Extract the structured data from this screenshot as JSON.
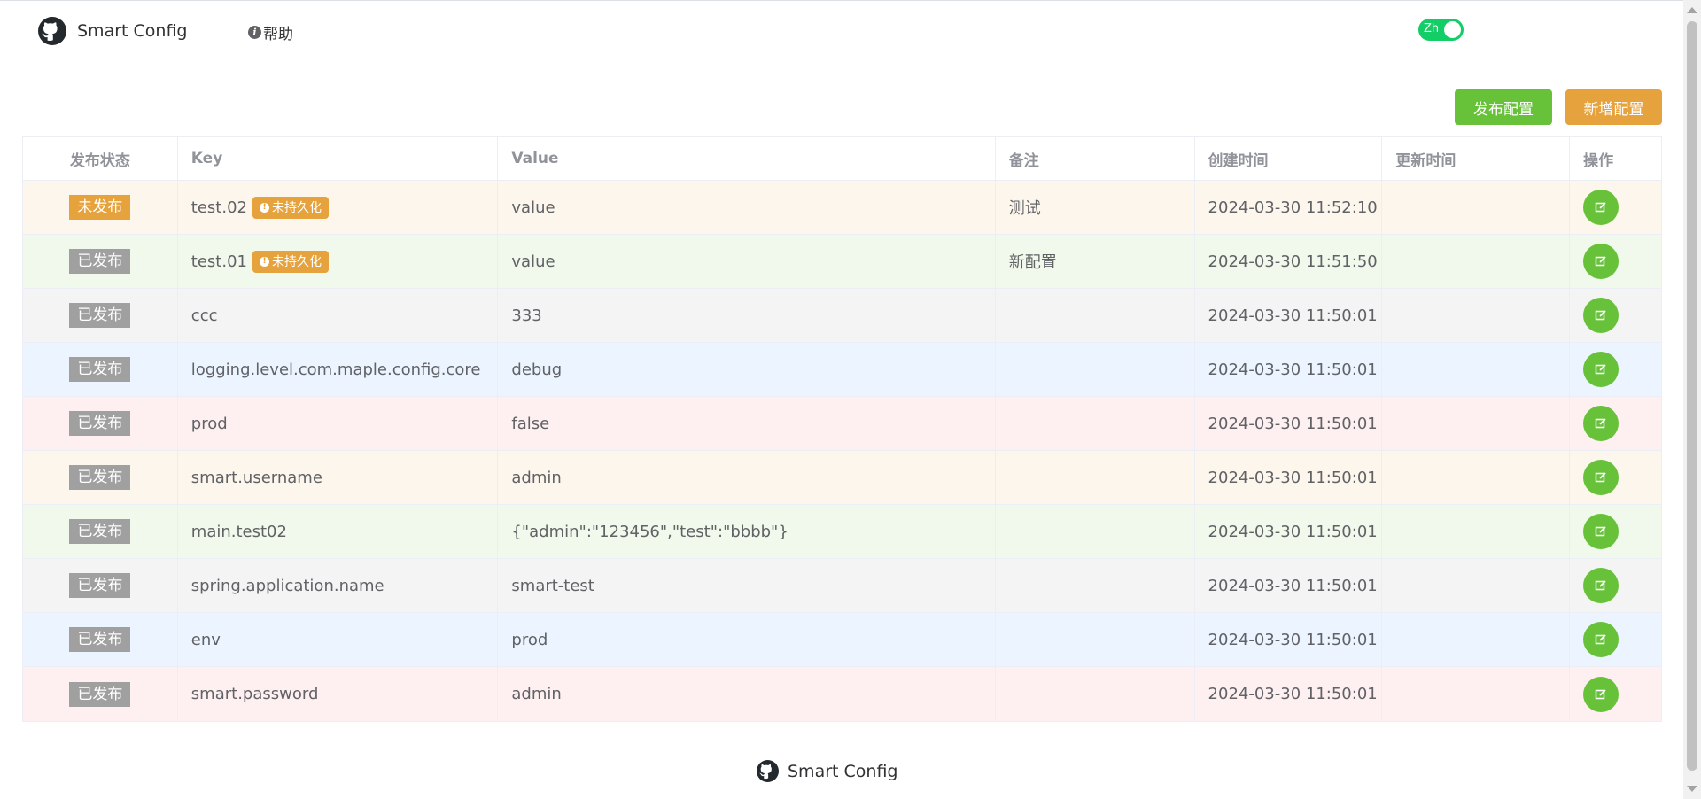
{
  "header": {
    "brand": "Smart Config",
    "help_label": "帮助",
    "lang_label": "Zh"
  },
  "toolbar": {
    "publish_label": "发布配置",
    "add_label": "新增配置"
  },
  "table": {
    "columns": [
      "发布状态",
      "Key",
      "Value",
      "备注",
      "创建时间",
      "更新时间",
      "操作"
    ],
    "rows": [
      {
        "status": "未发布",
        "key": "test.02",
        "tag": "未持久化",
        "value": "value",
        "remark": "测试",
        "created": "2024-03-30 11:52:10",
        "updated": ""
      },
      {
        "status": "已发布",
        "key": "test.01",
        "tag": "未持久化",
        "value": "value",
        "remark": "新配置",
        "created": "2024-03-30 11:51:50",
        "updated": ""
      },
      {
        "status": "已发布",
        "key": "ccc",
        "tag": "",
        "value": "333",
        "remark": "",
        "created": "2024-03-30 11:50:01",
        "updated": ""
      },
      {
        "status": "已发布",
        "key": "logging.level.com.maple.config.core",
        "tag": "",
        "value": "debug",
        "remark": "",
        "created": "2024-03-30 11:50:01",
        "updated": ""
      },
      {
        "status": "已发布",
        "key": "prod",
        "tag": "",
        "value": "false",
        "remark": "",
        "created": "2024-03-30 11:50:01",
        "updated": ""
      },
      {
        "status": "已发布",
        "key": "smart.username",
        "tag": "",
        "value": "admin",
        "remark": "",
        "created": "2024-03-30 11:50:01",
        "updated": ""
      },
      {
        "status": "已发布",
        "key": "main.test02",
        "tag": "",
        "value": "{\"admin\":\"123456\",\"test\":\"bbbb\"}",
        "remark": "",
        "created": "2024-03-30 11:50:01",
        "updated": ""
      },
      {
        "status": "已发布",
        "key": "spring.application.name",
        "tag": "",
        "value": "smart-test",
        "remark": "",
        "created": "2024-03-30 11:50:01",
        "updated": ""
      },
      {
        "status": "已发布",
        "key": "env",
        "tag": "",
        "value": "prod",
        "remark": "",
        "created": "2024-03-30 11:50:01",
        "updated": ""
      },
      {
        "status": "已发布",
        "key": "smart.password",
        "tag": "",
        "value": "admin",
        "remark": "",
        "created": "2024-03-30 11:50:01",
        "updated": ""
      }
    ]
  },
  "footer": {
    "brand": "Smart Config"
  },
  "icons": {
    "logo": "github-icon",
    "help": "info-circle-icon",
    "edit": "edit-icon",
    "tag": "exclamation-circle-icon"
  },
  "colors": {
    "primary_success": "#67c23a",
    "warning": "#e6a23c",
    "switch_on": "#13ce66",
    "published_tag": "#a0a0a0"
  }
}
